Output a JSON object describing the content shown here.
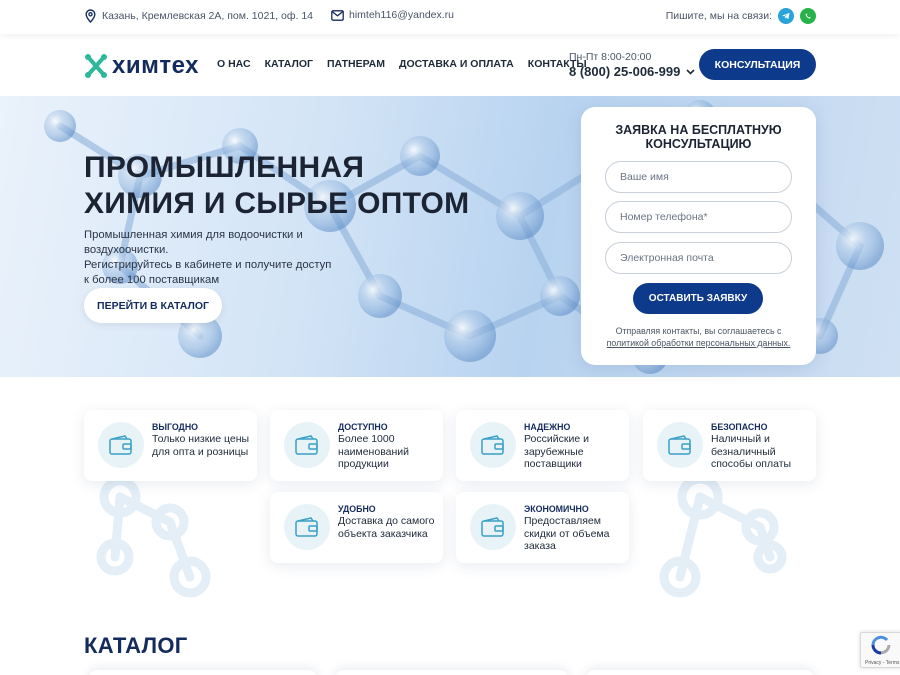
{
  "topbar": {
    "address": "Казань, Кремлевская 2А, пом. 1021, оф. 14",
    "email": "himteh116@yandex.ru",
    "contact_text": "Пишите, мы на связи:",
    "icons": [
      "location-icon",
      "mail-icon",
      "telegram-icon",
      "whatsapp-icon"
    ]
  },
  "header": {
    "logo_text": "химтех",
    "nav": [
      "О НАС",
      "КАТАЛОГ",
      "ПАТНЕРАМ",
      "ДОСТАВКА И ОПЛАТА",
      "КОНТАКТЫ"
    ],
    "hours": "Пн-Пт 8:00-20:00",
    "phone": "8 (800) 25-006-999",
    "consult_button": "КОНСУЛЬТАЦИЯ"
  },
  "hero": {
    "title_line1": "ПРОМЫШЛЕННАЯ",
    "title_line2": "ХИМИЯ И СЫРЬЕ ОПТОМ",
    "desc_line1": "Промышленная химия для водоочистки и воздухоочистки.",
    "desc_line2": "Регистрируйтесь в кабинете и получите доступ",
    "desc_line3": "к более 100 поставщикам",
    "catalog_button": "ПЕРЕЙТИ В КАТАЛОГ"
  },
  "form": {
    "title_line1": "ЗАЯВКА НА БЕСПЛАТНУЮ",
    "title_line2": "КОНСУЛЬТАЦИЮ",
    "name_placeholder": "Ваше имя",
    "phone_placeholder": "Номер телефона*",
    "email_placeholder": "Электронная почта",
    "submit": "ОСТАВИТЬ ЗАЯВКУ",
    "consent_text": "Отправляя контакты, вы соглашаетесь с",
    "consent_link": "политикой обработки персональных данных."
  },
  "features": [
    {
      "title": "ВЫГОДНО",
      "text": "Только низкие цены для опта и розницы"
    },
    {
      "title": "ДОСТУПНО",
      "text": "Более 1000 наименований продукции"
    },
    {
      "title": "НАДЕЖНО",
      "text": "Российские и зарубежные поставщики"
    },
    {
      "title": "БЕЗОПАСНО",
      "text": "Наличный и безналичный способы оплаты"
    },
    {
      "title": "УДОБНО",
      "text": "Доставка до самого объекта заказчика"
    },
    {
      "title": "ЭКОНОМИЧНО",
      "text": "Предоставляем скидки от объема заказа"
    }
  ],
  "catalog": {
    "title": "КАТАЛОГ"
  },
  "recaptcha": {
    "label": "Privacy - Terms"
  },
  "colors": {
    "primary": "#0d3a8a",
    "logo_green": "#2eb89a",
    "heading": "#142b5e"
  }
}
